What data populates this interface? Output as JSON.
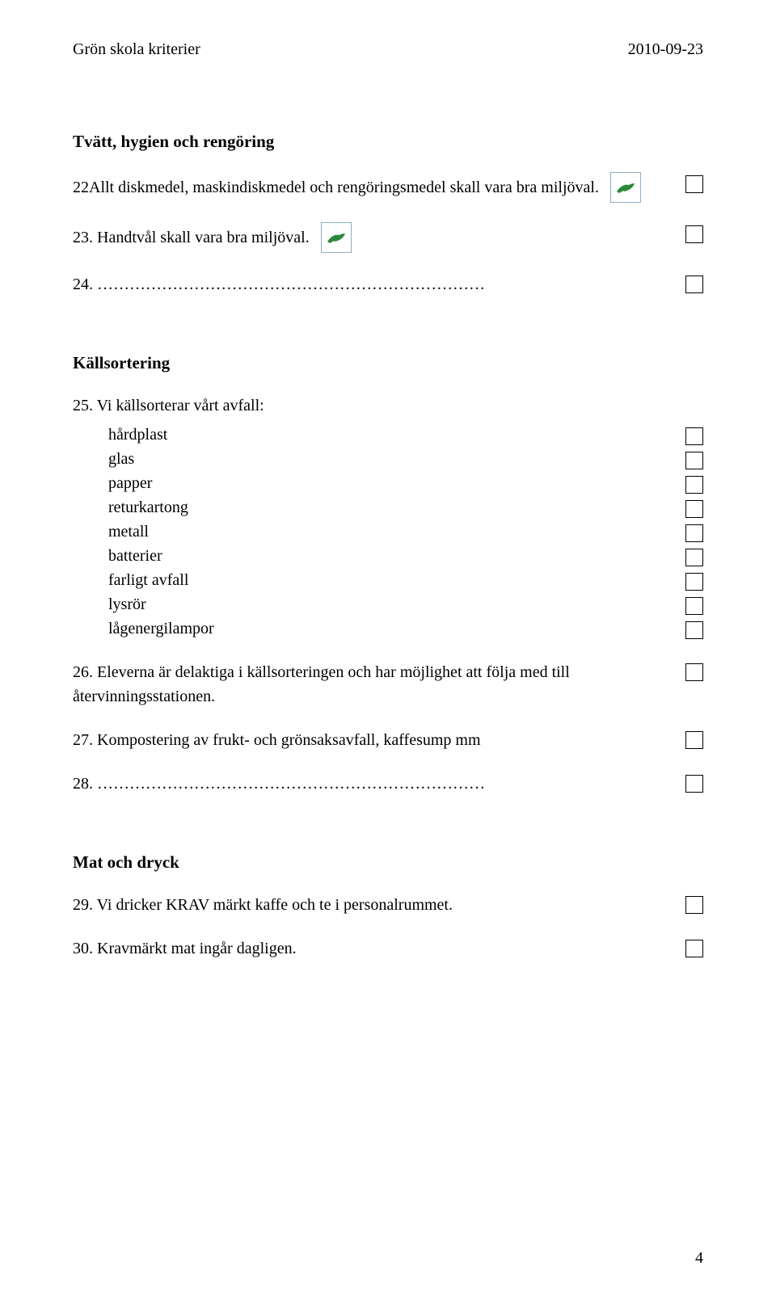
{
  "header": {
    "left": "Grön skola kriterier",
    "right": "2010-09-23"
  },
  "heading1": "Tvätt, hygien och rengöring",
  "item22": "22Allt diskmedel, maskindiskmedel och rengöringsmedel skall vara bra miljöval.",
  "item23": "23. Handtvål skall vara bra miljöval.",
  "item24": "24. ………………………………………………………………",
  "heading2": "Källsortering",
  "item25_lead": "25. Vi källsorterar vårt avfall:",
  "item25_items": [
    "hårdplast",
    "glas",
    "papper",
    "returkartong",
    "metall",
    "batterier",
    "farligt avfall",
    "lysrör",
    "lågenergilampor"
  ],
  "item26": "26. Eleverna är delaktiga i källsorteringen och har möjlighet att följa med till återvinningsstationen.",
  "item27": "27. Kompostering av frukt- och grönsaksavfall, kaffesump  mm",
  "item28": "28. ………………………………………………………………",
  "heading3": "Mat och dryck",
  "item29": "29. Vi dricker KRAV märkt kaffe och te i personalrummet.",
  "item30": "30. Kravmärkt mat ingår dagligen.",
  "page_number": "4"
}
